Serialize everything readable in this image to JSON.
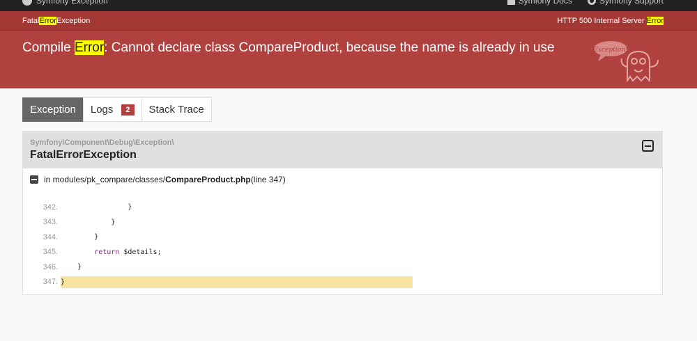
{
  "topbar": {
    "brand": "Symfony Exception",
    "links": [
      {
        "label": "Symfony Docs",
        "icon": "book-icon"
      },
      {
        "label": "Symfony Support",
        "icon": "lifebuoy-icon"
      }
    ]
  },
  "subbar": {
    "exception_pre": "Fatal",
    "exception_hl": "Error",
    "exception_post": "Exception",
    "status_pre": "HTTP 500 Internal Server ",
    "status_hl": "Error"
  },
  "title": {
    "pre": "Compile ",
    "hl": "Error",
    "post": ": Cannot declare class CompareProduct, because the name is already in use"
  },
  "tabs": [
    {
      "label": "Exception",
      "active": true
    },
    {
      "label": "Logs",
      "badge": "2"
    },
    {
      "label": "Stack Trace"
    }
  ],
  "exception": {
    "namespace": "Symfony\\Component\\Debug\\Exception\\",
    "class": "FatalErrorException"
  },
  "trace": {
    "prefix": "in modules/pk_compare/classes/",
    "file": "CompareProduct.php",
    "suffix": " (line 347)"
  },
  "code_lines": [
    {
      "num": "342.",
      "text": "                }"
    },
    {
      "num": "343.",
      "text": "            }"
    },
    {
      "num": "344.",
      "text": "        }"
    },
    {
      "num": "345.",
      "text": "        return $details;"
    },
    {
      "num": "346.",
      "text": "    }"
    },
    {
      "num": "347.",
      "text": "}"
    }
  ],
  "colors": {
    "header": "#b0413e",
    "highlight": "#ffff00",
    "selected_line": "#f8e4a0"
  }
}
